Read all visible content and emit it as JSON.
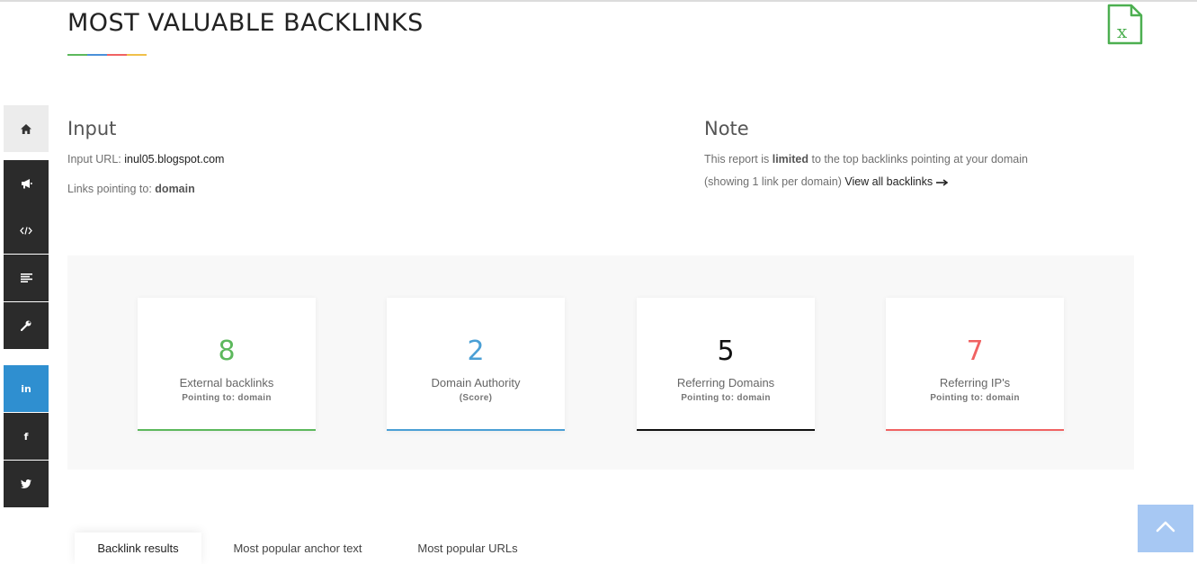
{
  "header": {
    "title": "MOST VALUABLE BACKLINKS",
    "underline_colors": [
      "#5cb85c",
      "#4a90d9",
      "#f06262",
      "#f0c04a"
    ],
    "export_icon": "excel-icon"
  },
  "sidebar": {
    "items": [
      {
        "icon": "home-icon",
        "bg": "#ececec",
        "color": "#333"
      },
      {
        "icon": "bullhorn-icon",
        "bg": "#2b2b2b",
        "color": "#fff"
      },
      {
        "icon": "code-icon",
        "bg": "#2b2b2b",
        "color": "#fff"
      },
      {
        "icon": "align-left-icon",
        "bg": "#2b2b2b",
        "color": "#fff"
      },
      {
        "icon": "wrench-icon",
        "bg": "#2b2b2b",
        "color": "#fff"
      },
      {
        "icon": "linkedin-icon",
        "label": "in",
        "bg": "#2f8fd0",
        "color": "#fff"
      },
      {
        "icon": "facebook-icon",
        "label": "f",
        "bg": "#2b2b2b",
        "color": "#fff"
      },
      {
        "icon": "twitter-icon",
        "bg": "#2b2b2b",
        "color": "#fff"
      }
    ]
  },
  "input": {
    "heading": "Input",
    "url_label": "Input URL:",
    "url_value": "inul05.blogspot.com",
    "links_label": "Links pointing to:",
    "links_value": "domain"
  },
  "note": {
    "heading": "Note",
    "text_before": "This report is",
    "text_bold": "limited",
    "text_after": "to the top backlinks pointing at your domain",
    "line2": "(showing 1 link per domain)",
    "link_label": "View all backlinks"
  },
  "stats": [
    {
      "value": "8",
      "label": "External backlinks",
      "sub": "Pointing to: domain",
      "color": "#5cb85c"
    },
    {
      "value": "2",
      "label": "Domain Authority",
      "sub": "(Score)",
      "color": "#4a9fd5"
    },
    {
      "value": "5",
      "label": "Referring Domains",
      "sub": "Pointing to: domain",
      "color": "#111111"
    },
    {
      "value": "7",
      "label": "Referring IP's",
      "sub": "Pointing to: domain",
      "color": "#f06262"
    }
  ],
  "tabs": [
    {
      "label": "Backlink results",
      "active": true
    },
    {
      "label": "Most popular anchor text",
      "active": false
    },
    {
      "label": "Most popular URLs",
      "active": false
    }
  ],
  "scroll_top": {
    "icon": "chevron-up-icon",
    "color": "#a7c8f3"
  }
}
